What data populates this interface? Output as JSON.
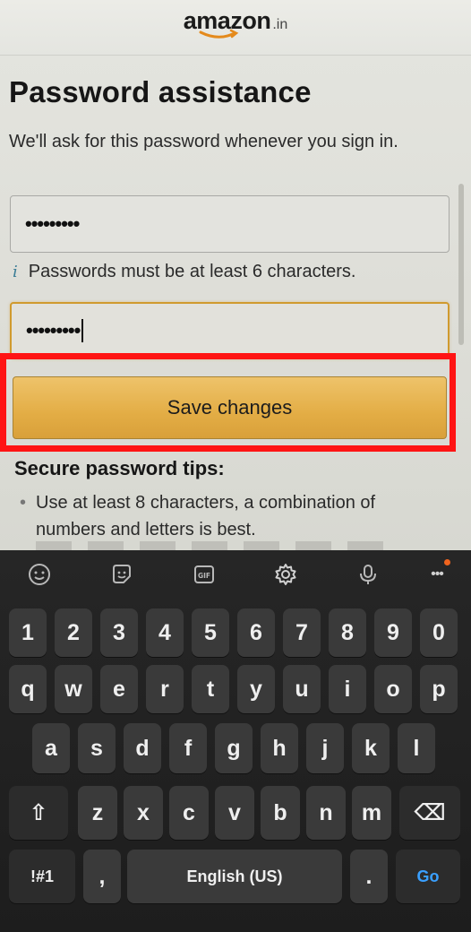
{
  "header": {
    "logo_word": "amazon",
    "logo_tld": ".in"
  },
  "form": {
    "title": "Password assistance",
    "subtitle": "We'll ask for this password whenever you sign in.",
    "password_value": "•••••••••",
    "confirm_value": "•••••••••",
    "hint_icon": "i",
    "hint_text": "Passwords must be at least 6 characters.",
    "save_label": "Save changes"
  },
  "tips": {
    "title": "Secure password tips:",
    "bullet": "•",
    "items": [
      "Use at least 8 characters, a combination of numbers and letters is best."
    ]
  },
  "keyboard": {
    "toolbar": [
      "emoji-icon",
      "sticker-icon",
      "gif-icon",
      "settings-icon",
      "microphone-icon",
      "more-icon"
    ],
    "gif_label": "GIF",
    "more_label": "•••",
    "number_row": [
      "1",
      "2",
      "3",
      "4",
      "5",
      "6",
      "7",
      "8",
      "9",
      "0"
    ],
    "row1": [
      "q",
      "w",
      "e",
      "r",
      "t",
      "y",
      "u",
      "i",
      "o",
      "p"
    ],
    "row2": [
      "a",
      "s",
      "d",
      "f",
      "g",
      "h",
      "j",
      "k",
      "l"
    ],
    "row3": [
      "z",
      "x",
      "c",
      "v",
      "b",
      "n",
      "m"
    ],
    "shift": "⇧",
    "backspace": "⌫",
    "symbols": "!#1",
    "comma": ",",
    "space": "English (US)",
    "period": ".",
    "go": "Go"
  },
  "colors": {
    "highlight": "#ff1414",
    "button": "#e3ad45",
    "accent_go": "#3aa0ff"
  }
}
